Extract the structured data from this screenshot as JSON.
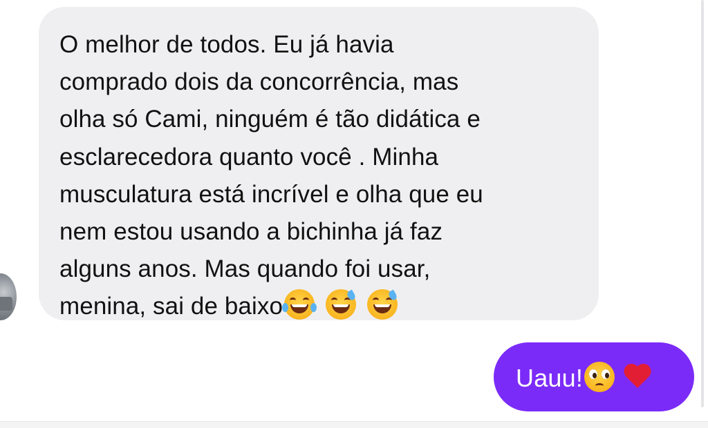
{
  "conversation": {
    "incoming_message": {
      "lines": [
        "O melhor de todos. Eu já havia",
        "comprado dois da concorrência, mas",
        "olha só Cami, ninguém é tão didática e",
        "esclarecedora quanto você . Minha",
        "musculatura está incrível e olha que eu",
        "nem estou usando a bichinha já faz",
        "alguns anos. Mas quando foi usar,",
        "menina, sai de baixo"
      ],
      "emojis": [
        "face-with-tears-of-joy-icon",
        "grinning-face-with-sweat-icon",
        "grinning-face-with-sweat-icon"
      ]
    },
    "outgoing_message": {
      "text": "Uauu!",
      "emojis": [
        "pleading-face-icon",
        "red-heart-icon"
      ]
    }
  },
  "colors": {
    "incoming_bubble": "#efeff1",
    "outgoing_bubble": "#7b2bf8",
    "incoming_text": "#111111",
    "outgoing_text": "#ffffff"
  }
}
